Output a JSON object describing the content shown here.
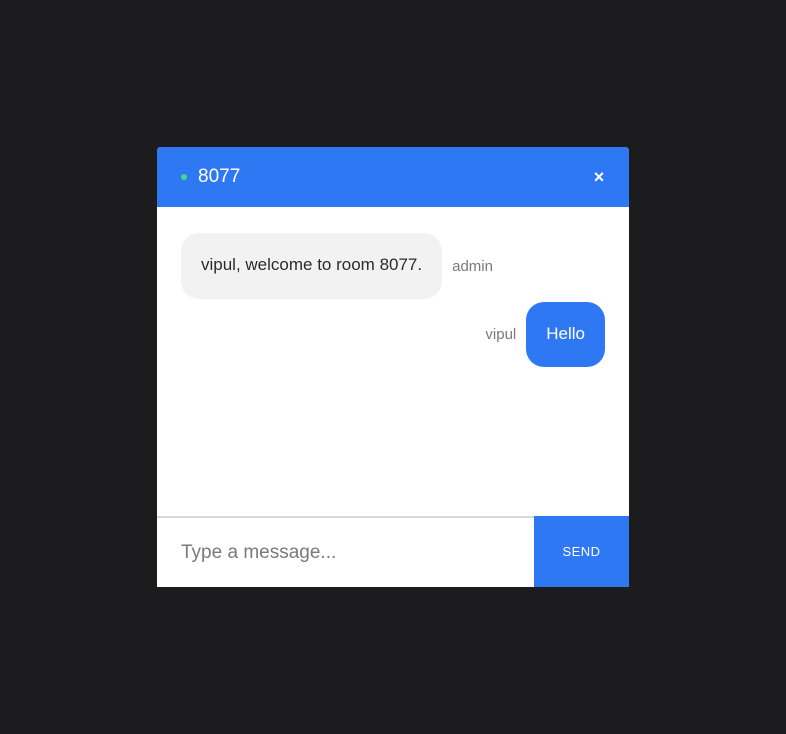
{
  "colors": {
    "page_background": "#1c1c1e",
    "accent": "#2f78f3",
    "status_online": "#3ddc84",
    "incoming_bubble": "#f2f2f2"
  },
  "header": {
    "room_name": "8077",
    "status_icon": "online-dot-icon",
    "close_icon": "close-icon",
    "close_label": "×"
  },
  "messages": [
    {
      "direction": "incoming",
      "text": "vipul, welcome to room 8077.",
      "sender": "admin"
    },
    {
      "direction": "outgoing",
      "text": "Hello",
      "sender": "vipul"
    }
  ],
  "composer": {
    "placeholder": "Type a message...",
    "value": "",
    "send_label": "SEND"
  }
}
